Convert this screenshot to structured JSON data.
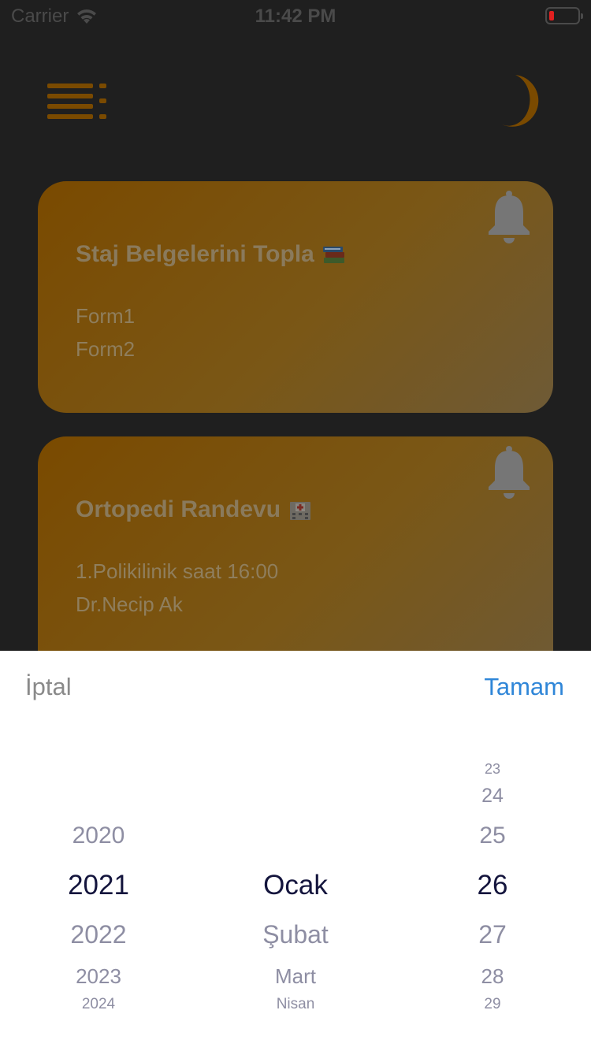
{
  "status_bar": {
    "carrier": "Carrier",
    "time": "11:42 PM"
  },
  "icons": {
    "menu": "menu-icon",
    "theme": "moon-icon",
    "bell": "bell-icon",
    "wifi": "wifi-icon",
    "battery": "battery-icon"
  },
  "colors": {
    "background": "#1f1f1f",
    "accent": "#ffa000",
    "done_button": "#2f86d8"
  },
  "cards": [
    {
      "title": "Staj Belgelerini Topla",
      "emoji": "books",
      "lines": [
        "Form1",
        "Form2"
      ]
    },
    {
      "title": "Ortopedi Randevu",
      "emoji": "hospital",
      "lines": [
        "1.Polikilinik saat 16:00",
        "Dr.Necip Ak"
      ]
    }
  ],
  "picker": {
    "cancel": "İptal",
    "done": "Tamam",
    "years": [
      "2020",
      "2021",
      "2022",
      "2023",
      "2024"
    ],
    "selected_year": "2021",
    "months": [
      "Ocak",
      "Şubat",
      "Mart",
      "Nisan"
    ],
    "selected_month": "Ocak",
    "days": [
      "23",
      "24",
      "25",
      "26",
      "27",
      "28",
      "29"
    ],
    "selected_day": "26"
  }
}
